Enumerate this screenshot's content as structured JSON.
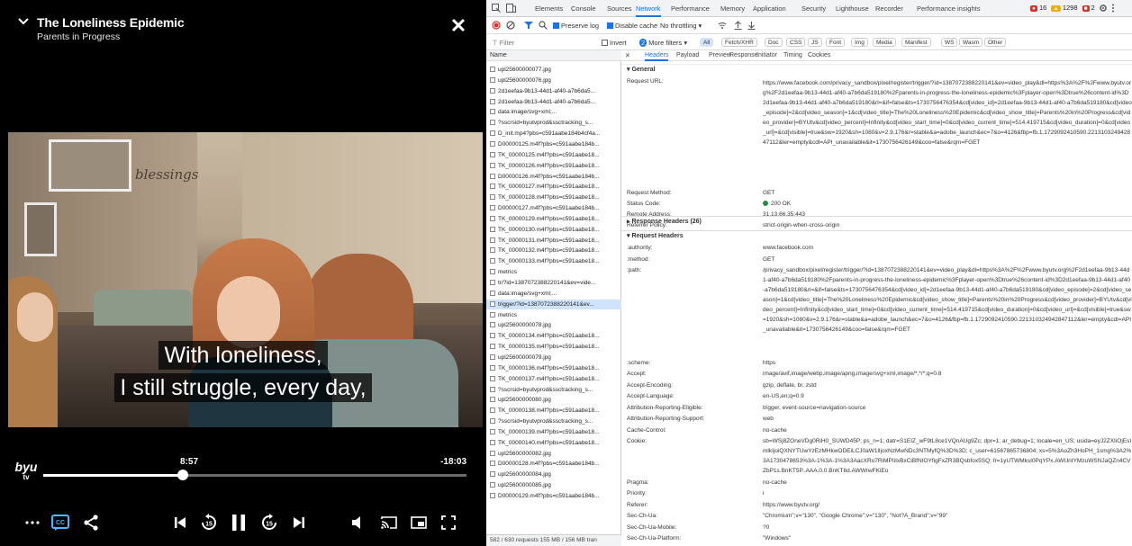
{
  "player": {
    "title": "The Loneliness Epidemic",
    "subtitle": "Parents in Progress",
    "scene_text": "blessings",
    "caption_line1": "With loneliness,",
    "caption_line2": "I still struggle, every day,",
    "logo_text": "byu",
    "logo_sub": "tv",
    "time_elapsed": "8:57",
    "time_remaining": "-18:03",
    "progress_fraction": 0.33
  },
  "devtools": {
    "tabs": [
      "Elements",
      "Console",
      "Sources",
      "Network",
      "Performance",
      "Memory",
      "Application",
      "Security",
      "Lighthouse",
      "Recorder",
      "Performance insights"
    ],
    "active_tab": "Network",
    "errors": "16",
    "warnings": "1298",
    "issues": "2",
    "toolbar": {
      "preserve_log": "Preserve log",
      "disable_cache": "Disable cache",
      "throttling": "No throttling"
    },
    "filter": {
      "placeholder": "Filter",
      "invert": "Invert",
      "more_filters": "More filters",
      "more_filters_count": "2",
      "types": [
        "All",
        "Fetch/XHR",
        "Doc",
        "CSS",
        "JS",
        "Font",
        "Img",
        "Media",
        "Manifest",
        "WS",
        "Wasm",
        "Other"
      ]
    },
    "list_header": "Name",
    "requests": [
      "upl25600000077.jpg",
      "upl25600000076.jpg",
      "2d1eefaa-9b13-44d1-af40-a7b6da5...",
      "2d1eefaa-9b13-44d1-af40-a7b6da5...",
      "data:image/svg+xml;...",
      "?sscrsid=byutvprod&ssctracking_s...",
      "D_init.mp4?pbs=c591aabe184b4cf4a...",
      "D00000125.m4f?pbs=c591aabe184b...",
      "TK_00000125.m4f?pbs=c591aabe18...",
      "TK_00000126.m4f?pbs=c591aabe18...",
      "D00000126.m4f?pbs=c591aabe184b...",
      "TK_00000127.m4f?pbs=c591aabe18...",
      "TK_00000128.m4f?pbs=c591aabe18...",
      "D00000127.m4f?pbs=c591aabe184b...",
      "TK_00000129.m4f?pbs=c591aabe18...",
      "TK_00000130.m4f?pbs=c591aabe18...",
      "TK_00000131.m4f?pbs=c591aabe18...",
      "TK_00000132.m4f?pbs=c591aabe18...",
      "TK_00000133.m4f?pbs=c591aabe18...",
      "metrics",
      "tr/?id=1387072388220141&ev=vide...",
      "data:image/svg+xml;...",
      "trigger/?id=1387072388220141&ev...",
      "metrics",
      "upl25600000078.jpg",
      "TK_00000134.m4f?pbs=c591aabe18...",
      "TK_00000135.m4f?pbs=c591aabe18...",
      "upl25600000079.jpg",
      "TK_00000136.m4f?pbs=c591aabe18...",
      "TK_00000137.m4f?pbs=c591aabe18...",
      "?sscrsid=byutvprod&ssctracking_s...",
      "upl25600000080.jpg",
      "TK_00000138.m4f?pbs=c591aabe18...",
      "?sscrsid=byutvprod&ssctracking_s...",
      "TK_00000139.m4f?pbs=c591aabe18...",
      "TK_00000140.m4f?pbs=c591aabe18...",
      "upl25600000082.jpg",
      "D00000128.m4f?pbs=c591aabe184b...",
      "upl25600000084.jpg",
      "upl25600000085.jpg",
      "D00000129.m4f?pbs=c591aabe184b..."
    ],
    "selected_request_index": 22,
    "status_bar": "582 / 630 requests   155 MB / 156 MB tran",
    "detail_tabs": [
      "Headers",
      "Payload",
      "Preview",
      "Response",
      "Initiator",
      "Timing",
      "Cookies"
    ],
    "active_detail_tab": "Headers",
    "general": {
      "label": "General",
      "request_url_key": "Request URL:",
      "request_url": "https://www.facebook.com/privacy_sandbox/pixel/register/trigger/?id=1387072388220141&ev=video_play&dl=https%3A%2F%2Fwww.byutv.org%2F2d1eefaa-9b13-44d1-af40-a7b6da519180%2Fparents-in-progress-the-loneliness-epidemic%3Fplayer-open%3Dtrue%26content-id%3D2d1eefaa-9b13-44d1-af40-a7b6da519180&rl=&if=false&ts=1730756476354&cd[video_id]=2d1eefaa-9b13-44d1-af40-a7b6da519180&cd[video_episode]=2&cd[video_season]=1&cd[video_title]=The%20Loneliness%20Epidemic&cd[video_show_title]=Parents%20in%20Progress&cd[video_provider]=BYUtv&cd[video_percent]=Infinity&cd[video_start_time]=0&cd[video_current_time]=514.419715&cd[video_duration]=0&cd[video_url]=&cd[visible]=true&sw=1920&sh=1080&v=2.9.176&r=stable&a=adobe_launch&ec=7&o=4126&fbp=fb.1.1729092410590.221310324942847112&ler=empty&cdl=API_unavailable&it=1730756426149&coo=false&rqm=FGET",
      "method_key": "Request Method:",
      "method": "GET",
      "status_key": "Status Code:",
      "status": "200 OK",
      "remote_key": "Remote Address:",
      "remote": "31.13.66.35:443",
      "referrer_key": "Referrer Policy:",
      "referrer": "strict-origin-when-cross-origin"
    },
    "response_headers_label": "Response Headers (26)",
    "request_headers_label": "Request Headers",
    "request_headers": [
      {
        "k": ":authority:",
        "v": "www.facebook.com"
      },
      {
        "k": ":method:",
        "v": "GET"
      },
      {
        "k": ":path:",
        "v": "/privacy_sandbox/pixel/register/trigger/?id=1387072388220141&ev=video_play&dl=https%3A%2F%2Fwww.byutv.org%2F2d1eefaa-9b13-44d1-af40-a7b6da519180%2Fparents-in-progress-the-loneliness-epidemic%3Fplayer-open%3Dtrue%26content-id%3D2d1eefaa-9b13-44d1-af40-a7b6da519180&rl=&if=false&ts=1730756476354&cd[video_id]=2d1eefaa-9b13-44d1-af40-a7b6da519180&cd[video_episode]=2&cd[video_season]=1&cd[video_title]=The%20Loneliness%20Epidemic&cd[video_show_title]=Parents%20in%20Progress&cd[video_provider]=BYUtv&cd[video_percent]=Infinity&cd[video_start_time]=0&cd[video_current_time]=514.419715&cd[video_duration]=0&cd[video_url]=&cd[visible]=true&sw=1920&sh=1080&v=2.9.176&r=stable&a=adobe_launch&ec=7&o=4126&fbp=fb.1.1729092410590.221310324942847112&ler=empty&cdl=API_unavailable&it=1730756426149&coo=false&rqm=FGET"
      },
      {
        "k": ":scheme:",
        "v": "https"
      },
      {
        "k": "Accept:",
        "v": "image/avif,image/webp,image/apng,image/svg+xml,image/*,*/*;q=0.8"
      },
      {
        "k": "Accept-Encoding:",
        "v": "gzip, deflate, br, zstd"
      },
      {
        "k": "Accept-Language:",
        "v": "en-US,en;q=0.9"
      },
      {
        "k": "Attribution-Reporting-Eligible:",
        "v": "trigger, event-source=navigation-source"
      },
      {
        "k": "Attribution-Reporting-Support:",
        "v": "web"
      },
      {
        "k": "Cache-Control:",
        "v": "no-cache"
      },
      {
        "k": "Cookie:",
        "v": "sb=WSj8ZOneVDg0RiH0_SUWD45P; ps_n=1; datr=S1EIZ_wF9tL8ce1VQnAUg9Zc; dpr=1; ar_debug=1; locale=en_US; usida=eyJ2ZXIiOjEsImlkIjoiQXNYTUwYzEzMHkwODEiLCJ0aW1lIjoxNzMwNDc3NTMyfQ%3D%3D; c_user=61567865736804; xs=5%3AoZh3HoPH_1smg%3A2%3A1730478653%3A-1%3A-1%3A3AacXRo7RiMPIiIxBxCiBfNIOYfigFxZR3BQsbfox5SQ; fr=1yUTWMksI0PqYPx.AWUntYMzuWSNJaQZn4CVZbP1s.BnKT5P..AAA.0.0.BnKT6d.AWWrwFKiEo"
      },
      {
        "k": "Pragma:",
        "v": "no-cache"
      },
      {
        "k": "Priority:",
        "v": "i"
      },
      {
        "k": "Referer:",
        "v": "https://www.byutv.org/"
      },
      {
        "k": "Sec-Ch-Ua:",
        "v": "\"Chromium\";v=\"130\", \"Google Chrome\";v=\"130\", \"Not?A_Brand\";v=\"99\""
      },
      {
        "k": "Sec-Ch-Ua-Mobile:",
        "v": "?0"
      },
      {
        "k": "Sec-Ch-Ua-Platform:",
        "v": "\"Windows\""
      }
    ]
  },
  "colors": {
    "accent": "#1a73e8",
    "status_ok": "#1e8e3e",
    "error": "#d93025",
    "warning": "#f9ab00",
    "issue": "#d93025"
  }
}
